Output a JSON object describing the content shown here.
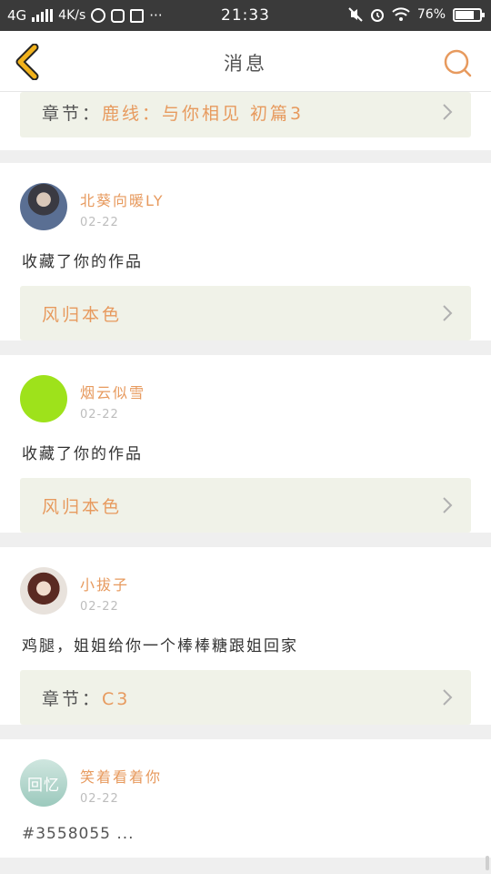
{
  "status_bar": {
    "network": "4G",
    "speed": "4K/s",
    "time": "21:33",
    "battery": "76%",
    "battery_level": 0.76
  },
  "header": {
    "title": "消息"
  },
  "top_card": {
    "link_prefix": "章节：",
    "link_value": "鹿线：与你相见 初篇3"
  },
  "messages": [
    {
      "username": "北葵向暖LY",
      "date": "02-22",
      "text": "收藏了你的作品",
      "link_prefix": "",
      "link_value": "风归本色"
    },
    {
      "username": "烟云似雪",
      "date": "02-22",
      "text": "收藏了你的作品",
      "link_prefix": "",
      "link_value": "风归本色"
    },
    {
      "username": "小拔子",
      "date": "02-22",
      "text": "鸡腿，姐姐给你一个棒棒糖跟姐回家",
      "link_prefix": "章节：",
      "link_value": "C3"
    },
    {
      "username": "笑着看着你",
      "date": "02-22",
      "text": "#3558055 ...",
      "avatar_text": "回忆"
    }
  ],
  "colors": {
    "accent": "#e79a5e",
    "back_arrow": "#f1b21c",
    "link_box_bg": "#f0f2e8",
    "avatar_green": "#9ee21b"
  }
}
